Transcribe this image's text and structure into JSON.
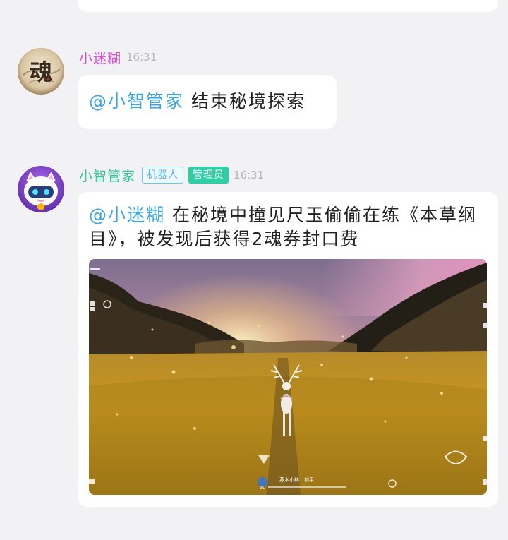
{
  "messages": [
    {
      "sender": "小迷糊",
      "time": "16:31",
      "mention": "@小智管家",
      "text": "结束秘境探索"
    },
    {
      "sender": "小智管家",
      "tags": [
        "机器人",
        "管理员"
      ],
      "time": "16:31",
      "mention": "@小迷糊",
      "text": "在秘境中撞见尺玉偷偷在练《本草纲目》，被发现后获得2魂券封口费"
    }
  ],
  "avatars": {
    "user_glyph": "魂"
  },
  "colors": {
    "user_name": "#d84fd8",
    "bot_name": "#2fc79c",
    "mention": "#3aa6e0",
    "robot_tag": "#5db7e0",
    "admin_tag_bg": "#2fcfa6"
  },
  "game_screenshot": {
    "hud_label_left": "燕水小林",
    "hud_label_right": "和平",
    "hud_level": "60"
  }
}
